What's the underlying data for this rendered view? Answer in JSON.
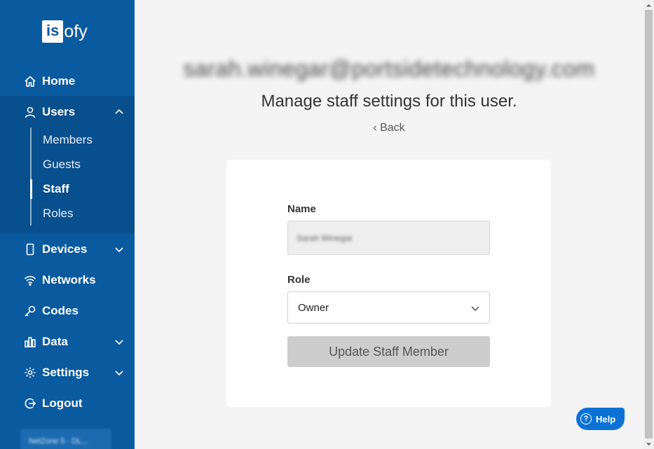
{
  "brand": {
    "logo_box": "is",
    "logo_rest": "ofy"
  },
  "sidebar": {
    "home": "Home",
    "users": "Users",
    "users_sub": [
      "Members",
      "Guests",
      "Staff",
      "Roles"
    ],
    "devices": "Devices",
    "networks": "Networks",
    "codes": "Codes",
    "data": "Data",
    "settings": "Settings",
    "logout": "Logout",
    "footer_badge": "NetZone 5 · DL..."
  },
  "main": {
    "email": "sarah.winegar@portsidetechnology.com",
    "subtitle": "Manage staff settings for this user.",
    "back": "Back"
  },
  "form": {
    "name_label": "Name",
    "name_value": "Sarah Winegar",
    "role_label": "Role",
    "role_value": "Owner",
    "submit_label": "Update Staff Member"
  },
  "help": {
    "label": "Help"
  },
  "colors": {
    "sidebar": "#0a5aa0",
    "active_section": "#084f8d",
    "help": "#0b72d4"
  }
}
